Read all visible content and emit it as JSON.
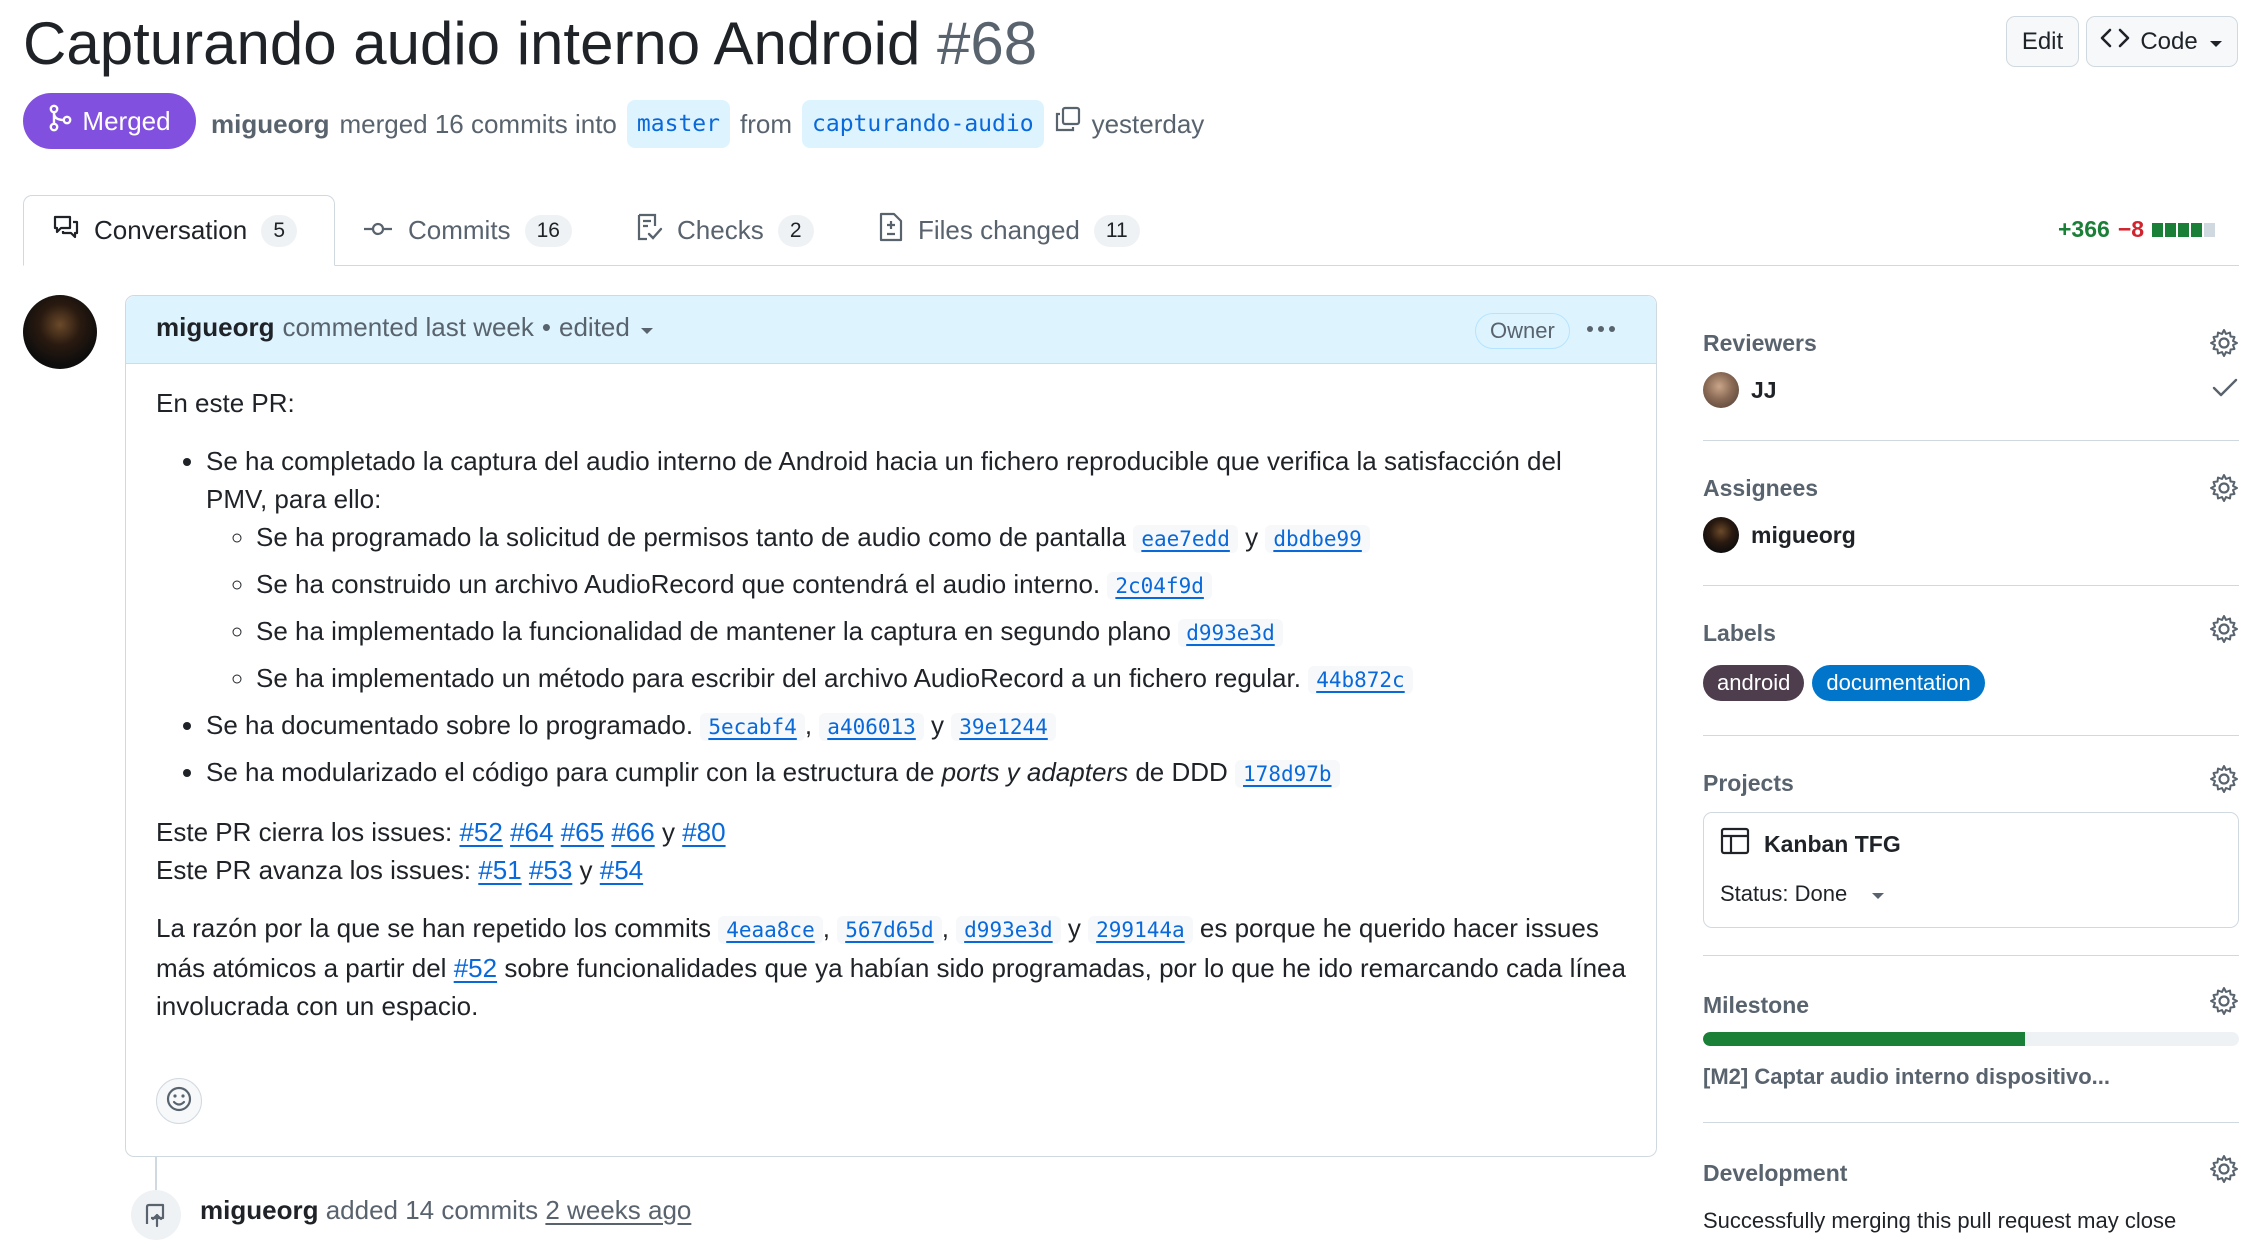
{
  "header": {
    "title": "Capturando audio interno Android",
    "number": "#68",
    "edit_label": "Edit",
    "code_label": "Code"
  },
  "state": {
    "badge": "Merged",
    "author": "migueorg",
    "merged_text": "merged 16 commits into",
    "base_branch": "master",
    "from_text": "from",
    "head_branch": "capturando-audio",
    "time": "yesterday"
  },
  "tabs": [
    {
      "label": "Conversation",
      "count": "5",
      "icon": "comment-discussion-icon"
    },
    {
      "label": "Commits",
      "count": "16",
      "icon": "git-commit-icon"
    },
    {
      "label": "Checks",
      "count": "2",
      "icon": "checklist-icon"
    },
    {
      "label": "Files changed",
      "count": "11",
      "icon": "file-diff-icon"
    }
  ],
  "diffstat": {
    "additions": "+366",
    "deletions": "−8",
    "boxes": [
      "green",
      "green",
      "green",
      "green",
      "gray"
    ]
  },
  "comment": {
    "author": "migueorg",
    "action": "commented last week",
    "separator": "•",
    "edited": "edited",
    "badge": "Owner",
    "intro": "En este PR:",
    "item1_text": "Se ha completado la captura del audio interno de Android hacia un fichero reproducible que verifica la satisfacción del PMV, para ello:",
    "sub1_text": "Se ha programado la solicitud de permisos tanto de audio como de pantalla",
    "sub1_sha1": "eae7edd",
    "sub1_and": "y",
    "sub1_sha2": "dbdbe99",
    "sub2_text": "Se ha construido un archivo AudioRecord que contendrá el audio interno.",
    "sub2_sha": "2c04f9d",
    "sub3_text": "Se ha implementado la funcionalidad de mantener la captura en segundo plano",
    "sub3_sha": "d993e3d",
    "sub4_text": "Se ha implementado un método para escribir del archivo AudioRecord a un fichero regular.",
    "sub4_sha": "44b872c",
    "item2_text": "Se ha documentado sobre lo programado.",
    "item2_sha1": "5ecabf4",
    "item2_sha2": "a406013",
    "item2_and": "y",
    "item2_sha3": "39e1244",
    "item3_text_a": "Se ha modularizado el código para cumplir con la estructura de",
    "item3_em": "ports y adapters",
    "item3_text_b": "de DDD",
    "item3_sha": "178d97b",
    "closes_text": "Este PR cierra los issues:",
    "closes": [
      "#52",
      "#64",
      "#65",
      "#66"
    ],
    "closes_and": "y",
    "closes_last": "#80",
    "advances_text": "Este PR avanza los issues:",
    "advances": [
      "#51",
      "#53"
    ],
    "advances_and": "y",
    "advances_last": "#54",
    "reason_a": "La razón por la que se han repetido los commits",
    "reason_sha1": "4eaa8ce",
    "reason_sha2": "567d65d",
    "reason_sha3": "d993e3d",
    "reason_and": "y",
    "reason_sha4": "299144a",
    "reason_b": "es porque he querido hacer issues más atómicos a partir del",
    "reason_issue": "#52",
    "reason_c": "sobre funcionalidades que ya habían sido programadas, por lo que he ido remarcando cada línea involucrada con un espacio."
  },
  "timeline": {
    "author": "migueorg",
    "action": "added 14 commits",
    "time": "2 weeks ago"
  },
  "sidebar": {
    "reviewers": {
      "title": "Reviewers",
      "user": "JJ"
    },
    "assignees": {
      "title": "Assignees",
      "user": "migueorg"
    },
    "labels": {
      "title": "Labels",
      "items": [
        {
          "name": "android",
          "color": "#4d3d4d"
        },
        {
          "name": "documentation",
          "color": "#0075ca"
        }
      ]
    },
    "projects": {
      "title": "Projects",
      "project_name": "Kanban TFG",
      "status": "Status: Done"
    },
    "milestone": {
      "title": "Milestone",
      "name": "[M2] Captar audio interno dispositivo...",
      "progress": 0.6
    },
    "development": {
      "title": "Development",
      "text": "Successfully merging this pull request may close"
    }
  },
  "colors": {
    "merged": "#8250df",
    "link": "#0969da",
    "addition": "#1a7f37",
    "deletion": "#d1242f"
  }
}
